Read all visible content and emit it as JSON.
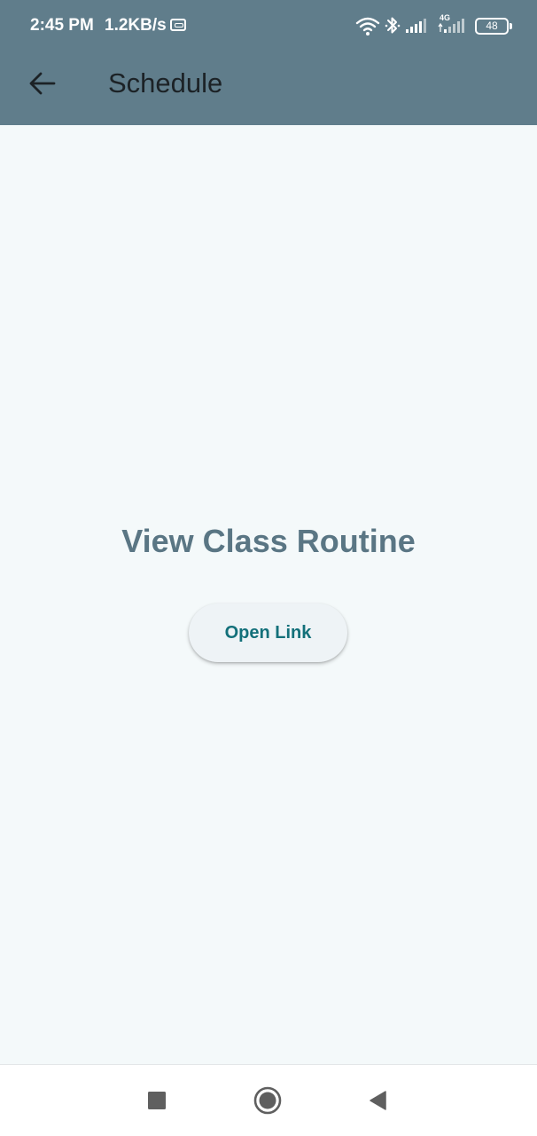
{
  "status_bar": {
    "time": "2:45 PM",
    "net_speed": "1.2KB/s",
    "network_type": "4G",
    "battery": "48",
    "icons": [
      "vpn-key-icon",
      "wifi-icon",
      "bluetooth-icon",
      "signal-icon",
      "signal-4g-icon",
      "battery-icon"
    ]
  },
  "app_bar": {
    "title": "Schedule",
    "back_icon": "arrow-left-icon"
  },
  "main": {
    "headline": "View Class Routine",
    "button_label": "Open Link"
  },
  "nav_bar": {
    "icons": [
      "recent-apps-square-icon",
      "home-circle-icon",
      "back-triangle-icon"
    ]
  },
  "colors": {
    "app_bar": "#607d8b",
    "background": "#f4f9fa",
    "headline": "#5a7684",
    "button_text": "#13707a",
    "button_bg": "#eef3f6"
  }
}
